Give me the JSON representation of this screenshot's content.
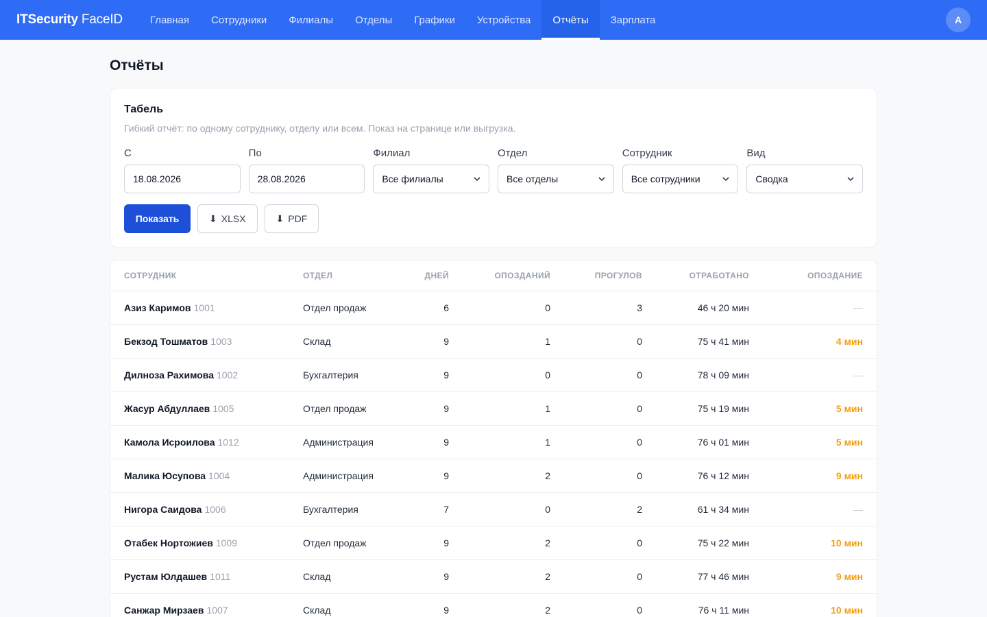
{
  "brand": {
    "bold": "ITSecurity",
    "light": "FaceID"
  },
  "nav": [
    "Главная",
    "Сотрудники",
    "Филиалы",
    "Отделы",
    "Графики",
    "Устройства",
    "Отчёты",
    "Зарплата"
  ],
  "nav_active": "Отчёты",
  "avatar_letter": "A",
  "page_title": "Отчёты",
  "report": {
    "title": "Табель",
    "subtitle": "Гибкий отчёт: по одному сотруднику, отделу или всем. Показ на странице или выгрузка.",
    "fields": {
      "from": {
        "label": "С",
        "value": "18.08.2026"
      },
      "to": {
        "label": "По",
        "value": "28.08.2026"
      },
      "branch": {
        "label": "Филиал",
        "value": "Все филиалы"
      },
      "department": {
        "label": "Отдел",
        "value": "Все отделы"
      },
      "employee": {
        "label": "Сотрудник",
        "value": "Все сотрудники"
      },
      "view": {
        "label": "Вид",
        "value": "Сводка"
      }
    },
    "buttons": {
      "show": "Показать",
      "xlsx": "XLSX",
      "pdf": "PDF"
    }
  },
  "table": {
    "headers": {
      "employee": "Сотрудник",
      "department": "Отдел",
      "days": "Дней",
      "lates": "Опозданий",
      "absences": "Прогулов",
      "worked": "Отработано",
      "late": "Опоздание"
    },
    "rows": [
      {
        "name": "Азиз Каримов",
        "id": "1001",
        "department": "Отдел продаж",
        "days": "6",
        "lates": "0",
        "absences": "3",
        "worked": "46 ч 20 мин",
        "late": "—"
      },
      {
        "name": "Бекзод Тошматов",
        "id": "1003",
        "department": "Склад",
        "days": "9",
        "lates": "1",
        "absences": "0",
        "worked": "75 ч 41 мин",
        "late": "4 мин"
      },
      {
        "name": "Дилноза Рахимова",
        "id": "1002",
        "department": "Бухгалтерия",
        "days": "9",
        "lates": "0",
        "absences": "0",
        "worked": "78 ч 09 мин",
        "late": "—"
      },
      {
        "name": "Жасур Абдуллаев",
        "id": "1005",
        "department": "Отдел продаж",
        "days": "9",
        "lates": "1",
        "absences": "0",
        "worked": "75 ч 19 мин",
        "late": "5 мин"
      },
      {
        "name": "Камола Исроилова",
        "id": "1012",
        "department": "Администрация",
        "days": "9",
        "lates": "1",
        "absences": "0",
        "worked": "76 ч 01 мин",
        "late": "5 мин"
      },
      {
        "name": "Малика Юсупова",
        "id": "1004",
        "department": "Администрация",
        "days": "9",
        "lates": "2",
        "absences": "0",
        "worked": "76 ч 12 мин",
        "late": "9 мин"
      },
      {
        "name": "Нигора Саидова",
        "id": "1006",
        "department": "Бухгалтерия",
        "days": "7",
        "lates": "0",
        "absences": "2",
        "worked": "61 ч 34 мин",
        "late": "—"
      },
      {
        "name": "Отабек Нортожиев",
        "id": "1009",
        "department": "Отдел продаж",
        "days": "9",
        "lates": "2",
        "absences": "0",
        "worked": "75 ч 22 мин",
        "late": "10 мин"
      },
      {
        "name": "Рустам Юлдашев",
        "id": "1011",
        "department": "Склад",
        "days": "9",
        "lates": "2",
        "absences": "0",
        "worked": "77 ч 46 мин",
        "late": "9 мин"
      },
      {
        "name": "Санжар Мирзаев",
        "id": "1007",
        "department": "Склад",
        "days": "9",
        "lates": "2",
        "absences": "0",
        "worked": "76 ч 11 мин",
        "late": "10 мин"
      }
    ]
  },
  "colors": {
    "primary": "#2f6cf6",
    "button": "#1d4fd8",
    "late": "#f59e0b"
  },
  "icons": {
    "select": "chevron-down-icon",
    "download": "download-icon"
  }
}
